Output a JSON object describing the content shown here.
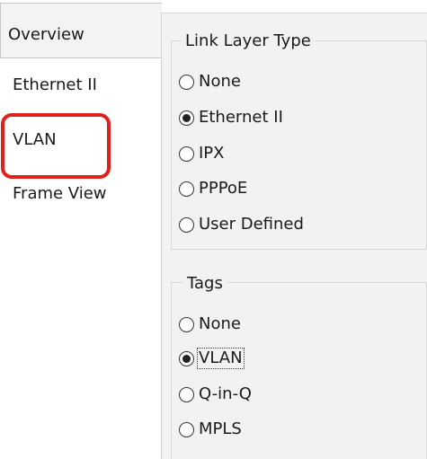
{
  "tabs": [
    {
      "label": "Overview",
      "selected": true
    },
    {
      "label": "Ethernet II",
      "selected": false
    },
    {
      "label": "VLAN",
      "selected": false,
      "highlighted": true
    },
    {
      "label": "Frame View",
      "selected": false
    }
  ],
  "highlight_color": "#e0201c",
  "link_layer_group": {
    "title": "Link Layer Type",
    "options": [
      {
        "label": "None",
        "checked": false
      },
      {
        "label": "Ethernet II",
        "checked": true
      },
      {
        "label": "IPX",
        "checked": false
      },
      {
        "label": "PPPoE",
        "checked": false
      },
      {
        "label": "User Defined",
        "checked": false
      }
    ]
  },
  "tags_group": {
    "title": "Tags",
    "options": [
      {
        "label": "None",
        "checked": false
      },
      {
        "label": "VLAN",
        "checked": true,
        "focused": true
      },
      {
        "label": "Q-in-Q",
        "checked": false
      },
      {
        "label": "MPLS",
        "checked": false
      }
    ]
  }
}
